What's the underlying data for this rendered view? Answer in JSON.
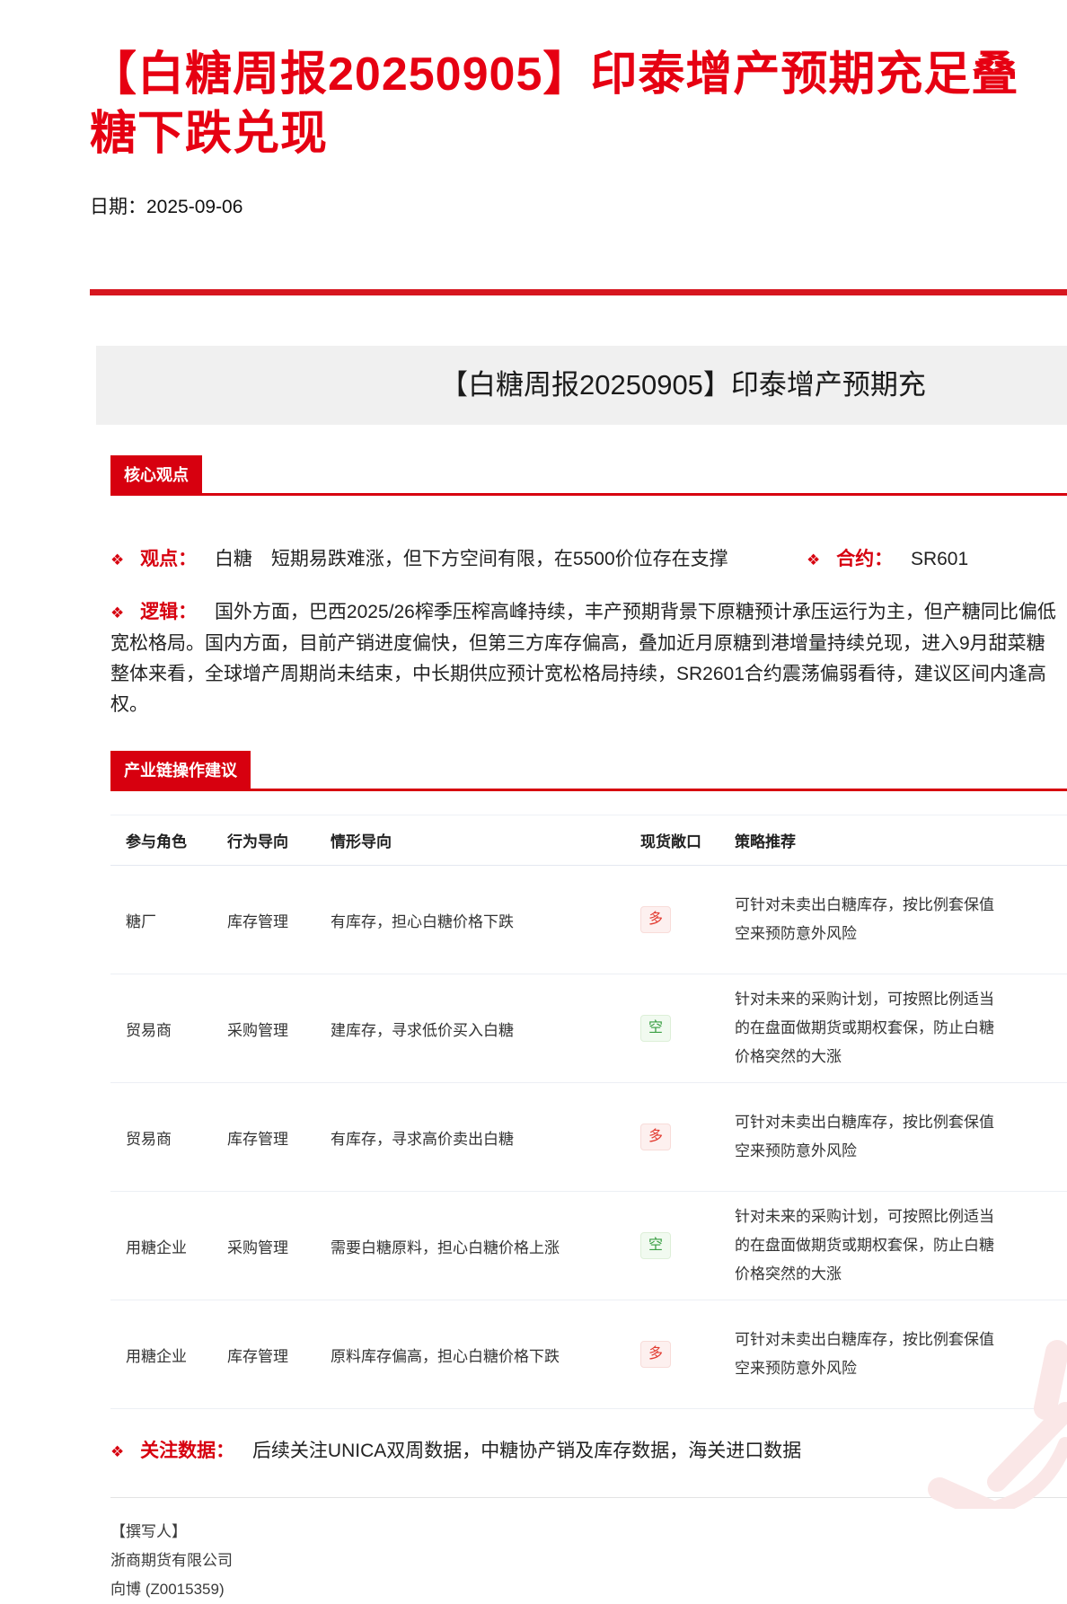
{
  "report": {
    "title_line1": "【白糖周报20250905】印泰增产预期充足叠",
    "title_line2": "糖下跌兑现",
    "date": "日期：2025-09-06",
    "banner_title": "【白糖周报20250905】印泰增产预期充"
  },
  "ui": {
    "bullet_icon": "❖"
  },
  "core_section": {
    "label": "核心观点",
    "viewpoint_label": "观点：",
    "viewpoint_text": "白糖　短期易跌难涨，但下方空间有限，在5500价位存在支撑",
    "contract_label": "合约：",
    "contract_value": "SR601",
    "logic_label": "逻辑：",
    "logic_line1": "国外方面，巴西2025/26榨季压榨高峰持续，丰产预期背景下原糖预计承压运行为主，但产糖同比偏低",
    "logic_line2": "宽松格局。国内方面，目前产销进度偏快，但第三方库存偏高，叠加近月原糖到港增量持续兑现，进入9月甜菜糖",
    "logic_line3": "整体来看，全球增产周期尚未结束，中长期供应预计宽松格局持续，SR2601合约震荡偏弱看待，建议区间内逢高",
    "logic_line4": "权。"
  },
  "suggestion_section": {
    "label": "产业链操作建议",
    "headers": [
      "参与角色",
      "行为导向",
      "情形导向",
      "现货敞口",
      "策略推荐"
    ],
    "rows": [
      {
        "role": "糖厂",
        "behavior": "库存管理",
        "scenario": "有库存，担心白糖价格下跌",
        "exposure": "多",
        "strategy1": "可针对未卖出白糖库存，按比例套保值",
        "strategy2": "空来预防意外风险",
        "strategy3": ""
      },
      {
        "role": "贸易商",
        "behavior": "采购管理",
        "scenario": "建库存，寻求低价买入白糖",
        "exposure": "空",
        "strategy1": "针对未来的采购计划，可按照比例适当",
        "strategy2": "的在盘面做期货或期权套保，防止白糖",
        "strategy3": "价格突然的大涨"
      },
      {
        "role": "贸易商",
        "behavior": "库存管理",
        "scenario": "有库存，寻求高价卖出白糖",
        "exposure": "多",
        "strategy1": "可针对未卖出白糖库存，按比例套保值",
        "strategy2": "空来预防意外风险",
        "strategy3": ""
      },
      {
        "role": "用糖企业",
        "behavior": "采购管理",
        "scenario": "需要白糖原料，担心白糖价格上涨",
        "exposure": "空",
        "strategy1": "针对未来的采购计划，可按照比例适当",
        "strategy2": "的在盘面做期货或期权套保，防止白糖",
        "strategy3": "价格突然的大涨"
      },
      {
        "role": "用糖企业",
        "behavior": "库存管理",
        "scenario": "原料库存偏高，担心白糖价格下跌",
        "exposure": "多",
        "strategy1": "可针对未卖出白糖库存，按比例套保值",
        "strategy2": "空来预防意外风险",
        "strategy3": ""
      }
    ]
  },
  "data_watch": {
    "label": "关注数据：",
    "text": "后续关注UNICA双周数据，中糖协产销及库存数据，海关进口数据"
  },
  "footer": {
    "author_heading": "【撰写人】",
    "company": "浙商期货有限公司",
    "author": "向博 (Z0015359)"
  },
  "colors": {
    "title_red": "#e60012",
    "accent_red": "#d7000f",
    "long_tag_color": "#e23b30",
    "long_tag_bg": "#fdf0ef",
    "short_tag_color": "#3a9f43",
    "short_tag_bg": "#f1faf0",
    "banner_bg": "#f0f0f0"
  }
}
